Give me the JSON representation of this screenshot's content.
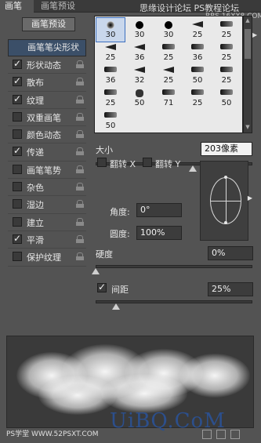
{
  "tabs": [
    {
      "label": "画笔"
    },
    {
      "label": "画笔预设"
    }
  ],
  "watermark_top": "思缘设计论坛 PS教程论坛",
  "watermark_top2": "BBS.16XX8.COM",
  "preset_button": "画笔预设",
  "tip_shape_header": "画笔笔尖形状",
  "options": [
    {
      "label": "形状动态",
      "checked": true,
      "lock": true
    },
    {
      "label": "散布",
      "checked": true,
      "lock": true
    },
    {
      "label": "纹理",
      "checked": true,
      "lock": true
    },
    {
      "label": "双重画笔",
      "checked": false,
      "lock": true
    },
    {
      "label": "颜色动态",
      "checked": false,
      "lock": true
    },
    {
      "label": "传递",
      "checked": true,
      "lock": true
    },
    {
      "label": "画笔笔势",
      "checked": false,
      "lock": true
    },
    {
      "label": "杂色",
      "checked": false,
      "lock": true
    },
    {
      "label": "湿边",
      "checked": false,
      "lock": true
    },
    {
      "label": "建立",
      "checked": false,
      "lock": true
    },
    {
      "label": "平滑",
      "checked": true,
      "lock": true
    },
    {
      "label": "保护纹理",
      "checked": false,
      "lock": true
    }
  ],
  "brush_rows": [
    [
      "30",
      "30",
      "30",
      "25",
      "25"
    ],
    [
      "25",
      "36",
      "25",
      "36",
      "25"
    ],
    [
      "36",
      "32",
      "25",
      "50",
      "25"
    ],
    [
      "25",
      "50",
      "71",
      "25",
      "50"
    ],
    [
      "50",
      "",
      "",
      "",
      ""
    ]
  ],
  "brush_glyphs": [
    [
      "soft",
      "hard",
      "hard",
      "tri",
      "wide"
    ],
    [
      "tri",
      "tri",
      "wide",
      "wide",
      "wide"
    ],
    [
      "wide",
      "tri",
      "tri",
      "wide",
      "wide"
    ],
    [
      "wide",
      "blob",
      "wide",
      "wide",
      "wide"
    ],
    [
      "wide",
      "",
      "",
      "",
      ""
    ]
  ],
  "size": {
    "label": "大小",
    "value": "203像素",
    "slider": 0.62
  },
  "flip": {
    "x_label": "翻转 X",
    "y_label": "翻转 Y",
    "x_checked": false,
    "y_checked": false
  },
  "angle": {
    "label": "角度:",
    "value": "0°"
  },
  "roundness": {
    "label": "圆度:",
    "value": "100%"
  },
  "hardness": {
    "label": "硬度",
    "value": "0%",
    "slider": 0.0
  },
  "spacing": {
    "label": "间距",
    "value": "25%",
    "checked": true,
    "slider": 0.13
  },
  "logo": "UiBQ.CoM",
  "watermark_bottom": "PS学堂 WWW.52PSXT.COM",
  "icons": [
    "camera-icon",
    "grid-icon",
    "new-brush-icon"
  ]
}
